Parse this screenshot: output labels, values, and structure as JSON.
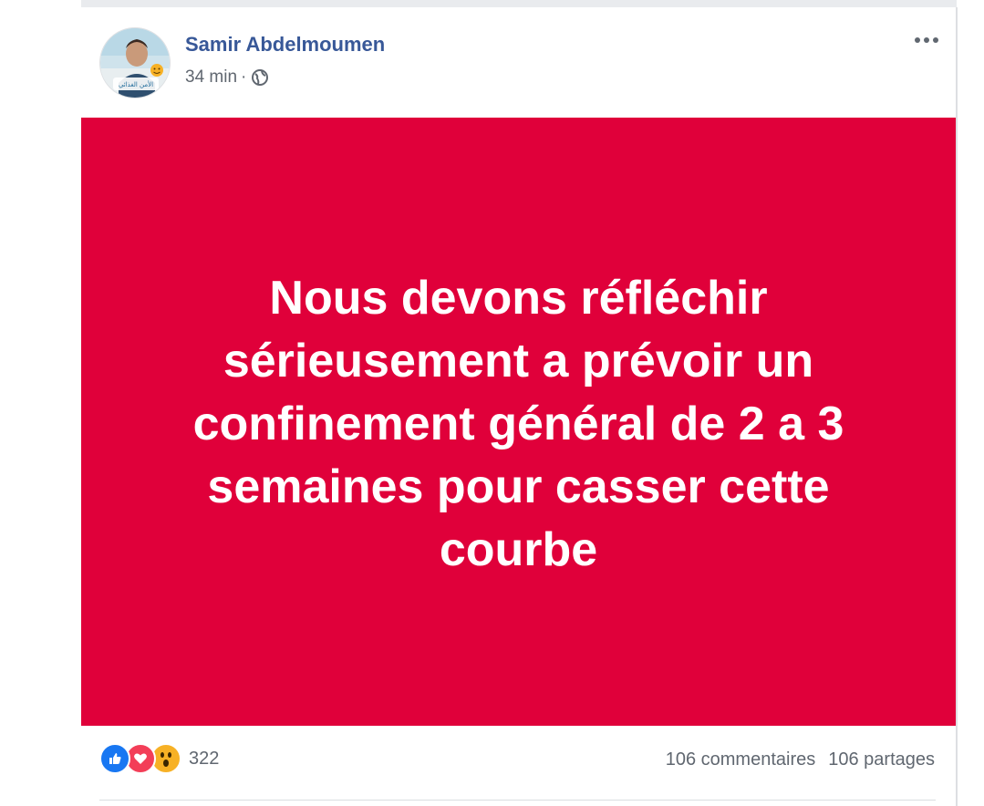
{
  "post": {
    "author": "Samir Abdelmoumen",
    "time": "34 min",
    "separator": "·",
    "privacy_icon": "globe-icon",
    "menu_icon": "more-options-icon",
    "avatar_icon": "profile-photo",
    "avatar_caption": "الأمن الغذائي",
    "banner_text": "Nous devons réfléchir sérieusement a prévoir un confinement général de 2 a 3 semaines pour casser cette courbe",
    "banner_color": "#e0003a"
  },
  "footer": {
    "reaction_icons": [
      "like-icon",
      "love-icon",
      "wow-icon"
    ],
    "reaction_count": "322",
    "comments": "106 commentaires",
    "shares": "106 partages"
  },
  "colors": {
    "author_link": "#385898",
    "meta_text": "#606770",
    "like": "#1877f2",
    "love": "#f33e58",
    "wow": "#f7b125"
  }
}
